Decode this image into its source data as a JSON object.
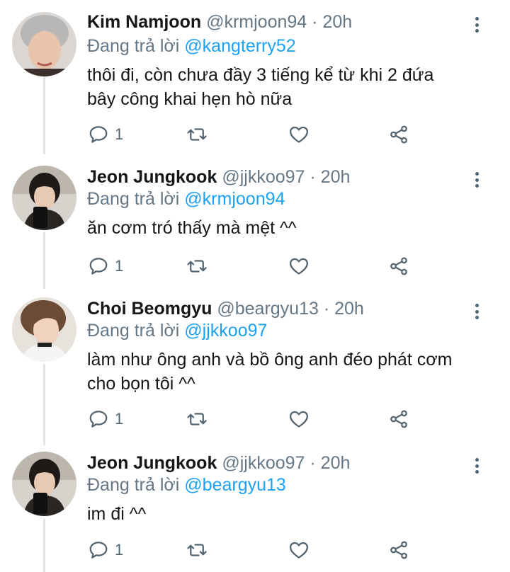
{
  "tweets": [
    {
      "name": "Kim Namjoon",
      "handle": "@krmjoon94",
      "time": "20h",
      "reply_prefix": "Đang trả lời",
      "reply_to": "@kangterry52",
      "text_lines": [
        "thôi đi, còn chưa đầy 3 tiếng kể từ khi 2 đứa",
        "bây công khai hẹn hò nữa"
      ],
      "reply_count": "1"
    },
    {
      "name": "Jeon Jungkook",
      "handle": "@jjkkoo97",
      "time": "20h",
      "reply_prefix": "Đang trả lời",
      "reply_to": "@krmjoon94",
      "text_lines": [
        "ăn cơm tró thấy mà mệt ^^"
      ],
      "reply_count": "1"
    },
    {
      "name": "Choi Beomgyu",
      "handle": "@beargyu13",
      "time": "20h",
      "reply_prefix": "Đang trả lời",
      "reply_to": "@jjkkoo97",
      "text_lines": [
        "làm như ông anh và bồ ông anh đéo phát cơm",
        "cho bọn tôi ^^"
      ],
      "reply_count": "1"
    },
    {
      "name": "Jeon Jungkook",
      "handle": "@jjkkoo97",
      "time": "20h",
      "reply_prefix": "Đang trả lời",
      "reply_to": "@beargyu13",
      "text_lines": [
        "im đi ^^"
      ],
      "reply_count": "1"
    }
  ],
  "separator": "·",
  "icons": {
    "reply": "reply-icon",
    "retweet": "retweet-icon",
    "like": "heart-icon",
    "share": "share-icon",
    "more": "more-vertical-icon"
  },
  "colors": {
    "name": "#14171a",
    "meta": "#657786",
    "mention": "#1da1f2",
    "icon": "#536471",
    "thread_line": "#dfe3e7"
  }
}
